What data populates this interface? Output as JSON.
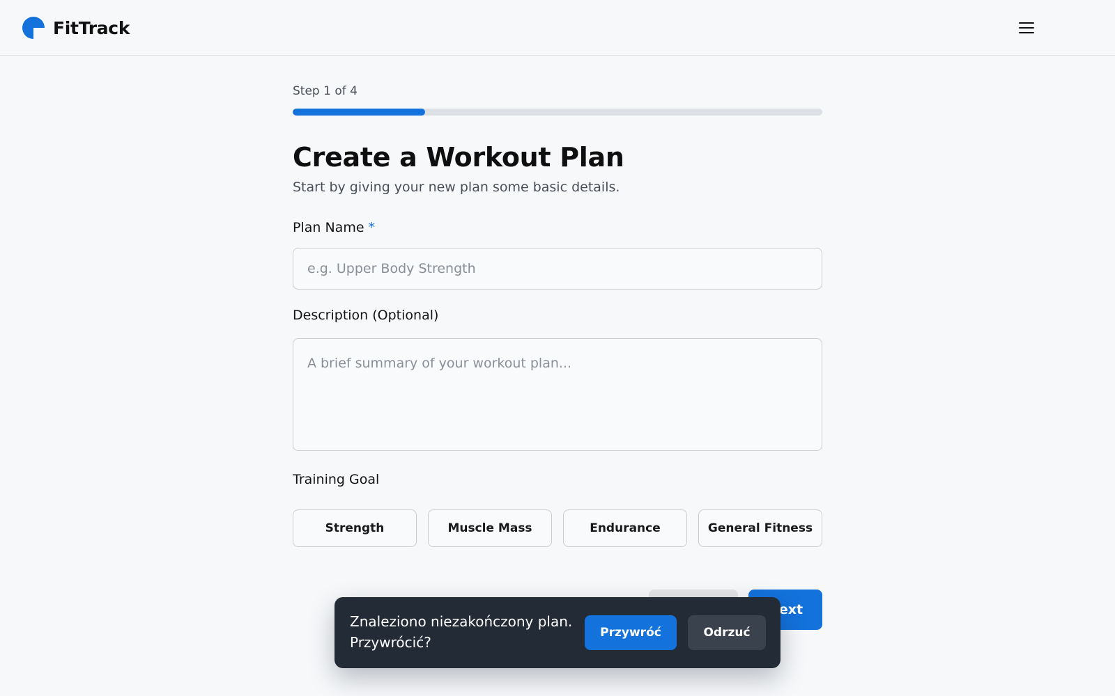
{
  "brand": {
    "name": "FitTrack",
    "accent": "#1372dc"
  },
  "header": {
    "menu_icon": "hamburger-menu-icon"
  },
  "progress": {
    "label": "Step 1 of 4",
    "current": 1,
    "total": 4,
    "fraction": 0.25
  },
  "page": {
    "title": "Create a Workout Plan",
    "subtitle": "Start by giving your new plan some basic details."
  },
  "form": {
    "plan_name": {
      "label": "Plan Name",
      "required_mark": "*",
      "value": "",
      "placeholder": "e.g. Upper Body Strength"
    },
    "description": {
      "label": "Description (Optional)",
      "value": "",
      "placeholder": "A brief summary of your workout plan..."
    },
    "goal": {
      "label": "Training Goal",
      "options": [
        "Strength",
        "Muscle Mass",
        "Endurance",
        "General Fitness"
      ]
    }
  },
  "actions": {
    "next_label": "Next"
  },
  "toast": {
    "message": "Znaleziono niezakończony plan. Przywrócić?",
    "restore_label": "Przywróć",
    "discard_label": "Odrzuć"
  }
}
